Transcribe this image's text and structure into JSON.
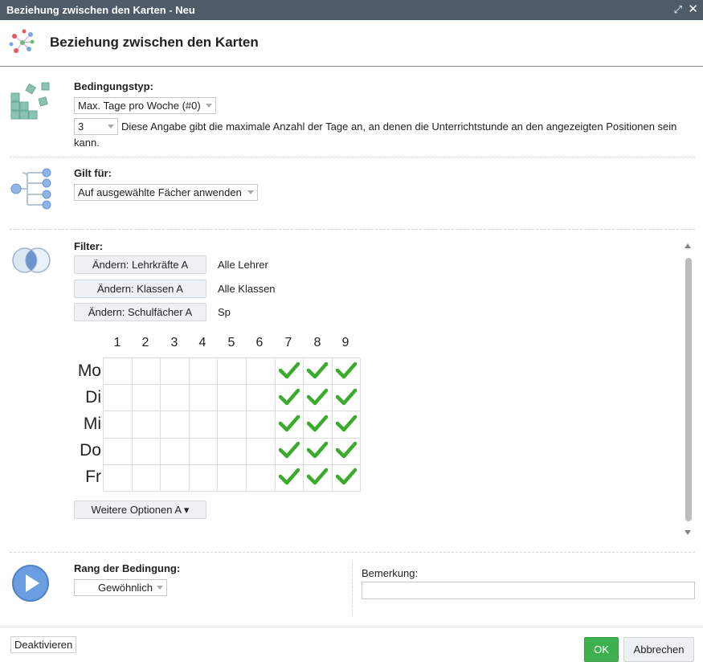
{
  "window": {
    "title": "Beziehung zwischen den Karten - Neu"
  },
  "header": {
    "title": "Beziehung zwischen den Karten"
  },
  "condition": {
    "label": "Bedingungstyp:",
    "type_value": "Max. Tage pro Woche (#0)",
    "count_value": "3",
    "description_line1": "Diese Angabe gibt die maximale Anzahl der Tage an, an denen die Unterrichtstunde an den angezeigten Positionen sein",
    "description_line2": "kann."
  },
  "applies": {
    "label": "Gilt für:",
    "value": "Auf ausgewählte Fächer anwenden"
  },
  "filter": {
    "label": "Filter:",
    "rows": [
      {
        "button": "Ändern: Lehrkräfte A",
        "value": "Alle Lehrer"
      },
      {
        "button": "Ändern: Klassen A",
        "value": "Alle Klassen"
      },
      {
        "button": "Ändern: Schulfächer A",
        "value": "Sp"
      }
    ]
  },
  "grid": {
    "columns": [
      "1",
      "2",
      "3",
      "4",
      "5",
      "6",
      "7",
      "8",
      "9"
    ],
    "rows": [
      "Mo",
      "Di",
      "Mi",
      "Do",
      "Fr"
    ],
    "checked_periods": [
      "7",
      "8",
      "9"
    ],
    "check_color": "#3aab2c"
  },
  "more_options": "Weitere Optionen A ▾",
  "rank": {
    "label": "Rang der Bedingung:",
    "value": "Gewöhnlich"
  },
  "remark": {
    "label": "Bemerkung:",
    "value": ""
  },
  "footer": {
    "deactivate": "Deaktivieren",
    "ok": "OK",
    "cancel": "Abbrechen"
  },
  "colors": {
    "titlebar": "#4f5b66",
    "ok": "#3fb04f",
    "icon_teal": "#7fb8a8",
    "icon_blue": "#7aa7e0"
  }
}
